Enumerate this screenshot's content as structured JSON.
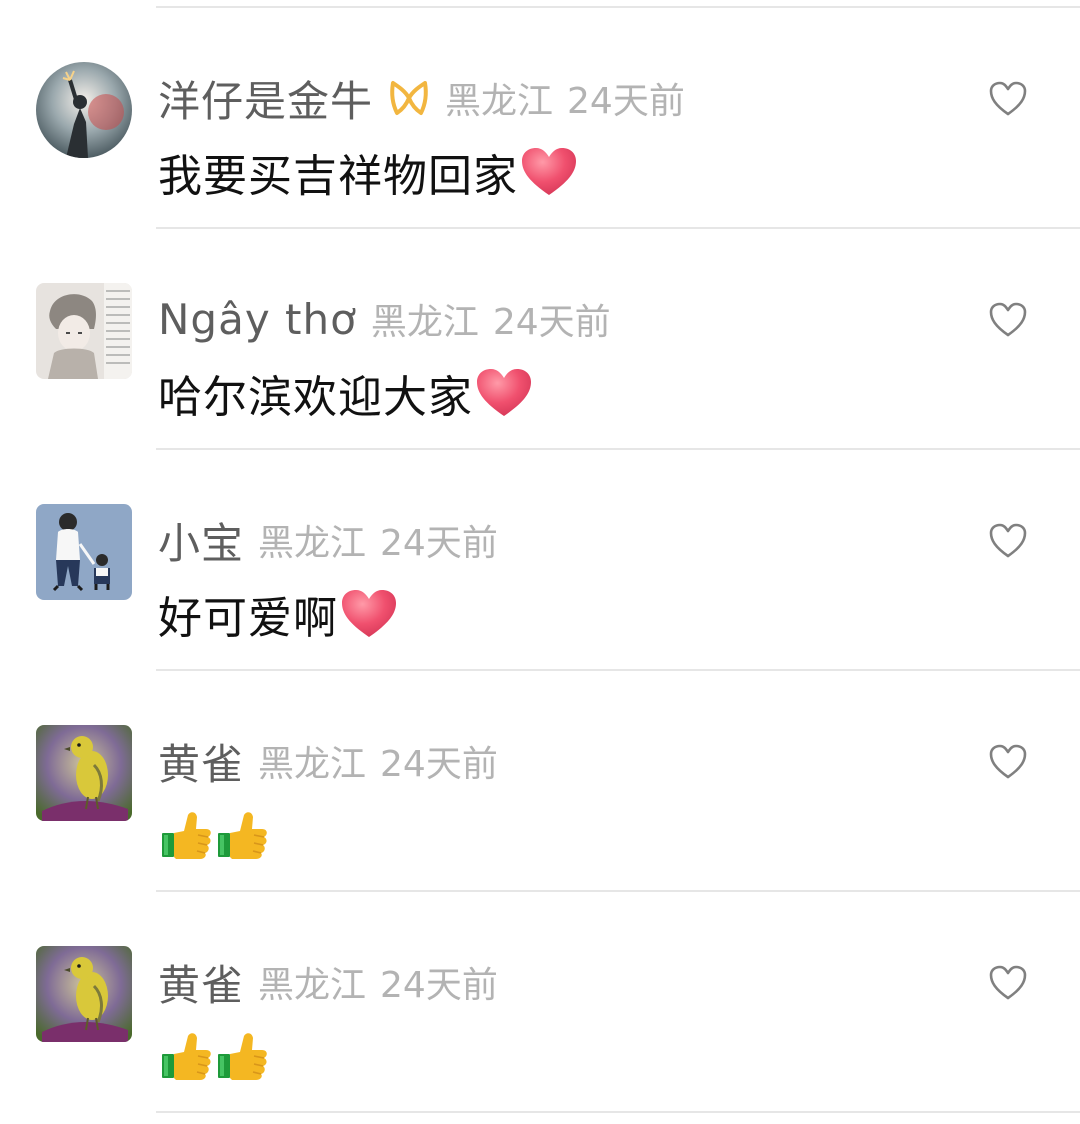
{
  "comments": [
    {
      "username": "洋仔是金牛",
      "badge": "ribbon-icon",
      "location": "黑龙江",
      "time": "24天前",
      "text": "我要买吉祥物回家",
      "emoji": [
        "heart"
      ],
      "avatar": "firework-person"
    },
    {
      "username": "Ngây thơ",
      "location": "黑龙江",
      "time": "24天前",
      "text": "哈尔滨欢迎大家",
      "emoji": [
        "heart"
      ],
      "avatar": "anime-boy-sketch"
    },
    {
      "username": "小宝",
      "location": "黑龙江",
      "time": "24天前",
      "text": "好可爱啊",
      "emoji": [
        "heart"
      ],
      "avatar": "father-and-child"
    },
    {
      "username": "黄雀",
      "location": "黑龙江",
      "time": "24天前",
      "text": "",
      "emoji": [
        "thumbs-up",
        "thumbs-up"
      ],
      "avatar": "yellow-bird"
    },
    {
      "username": "黄雀",
      "location": "黑龙江",
      "time": "24天前",
      "text": "",
      "emoji": [
        "thumbs-up",
        "thumbs-up"
      ],
      "avatar": "yellow-bird"
    }
  ],
  "colors": {
    "username": "#5e5e5e",
    "meta": "#b3b3b3",
    "text": "#111111",
    "divider": "#e6e6e6",
    "heart": "#f0506e",
    "badge": "#f2b640"
  }
}
